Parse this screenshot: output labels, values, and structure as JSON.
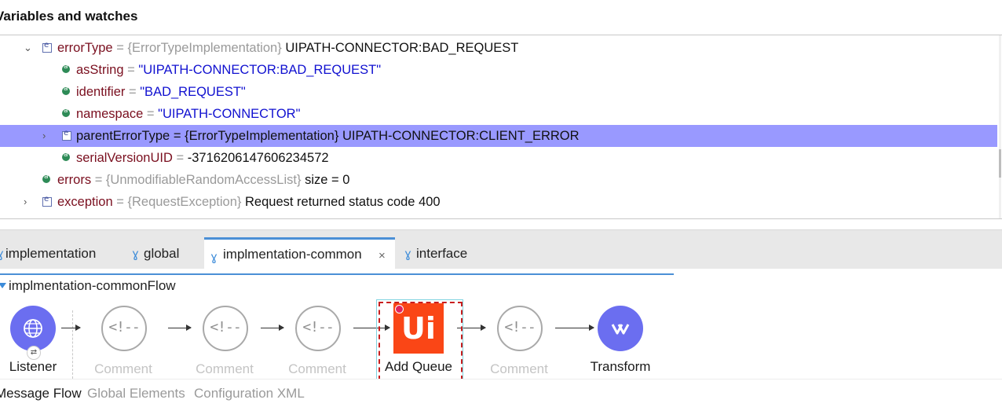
{
  "variables_panel": {
    "title": "Variables and watches",
    "rows": [
      {
        "name": "errorType",
        "sep": "=",
        "type": "{ErrorTypeImplementation}",
        "value": "UIPATH-CONNECTOR:BAD_REQUEST",
        "expanded": true,
        "icon": "entity-icon"
      },
      {
        "name": "asString",
        "sep": "=",
        "value": "\"UIPATH-CONNECTOR:BAD_REQUEST\"",
        "icon": "attribute-icon"
      },
      {
        "name": "identifier",
        "sep": "=",
        "value": "\"BAD_REQUEST\"",
        "icon": "attribute-icon"
      },
      {
        "name": "namespace",
        "sep": "=",
        "value": "\"UIPATH-CONNECTOR\"",
        "icon": "attribute-icon"
      },
      {
        "name": "parentErrorType",
        "sep": "=",
        "type": "{ErrorTypeImplementation}",
        "value": "UIPATH-CONNECTOR:CLIENT_ERROR",
        "expanded": false,
        "selected": true,
        "icon": "entity-icon"
      },
      {
        "name": "serialVersionUID",
        "sep": "=",
        "value": "-3716206147606234572",
        "icon": "attribute-icon"
      },
      {
        "name": "errors",
        "sep": "=",
        "type": "{UnmodifiableRandomAccessList}",
        "value": "size = 0",
        "icon": "attribute-icon"
      },
      {
        "name": "exception",
        "sep": "=",
        "type": "{RequestException}",
        "value": "Request returned status code 400",
        "expanded": false,
        "icon": "entity-icon"
      }
    ]
  },
  "editor_tabs": [
    {
      "label": "implementation",
      "active": false
    },
    {
      "label": "global",
      "active": false
    },
    {
      "label": "implmentation-common",
      "active": true,
      "close": "×"
    },
    {
      "label": "interface",
      "active": false
    }
  ],
  "flow": {
    "title": "implmentation-commonFlow",
    "nodes": [
      {
        "label": "Listener",
        "kind": "listener",
        "icon": "globe-icon"
      },
      {
        "label": "Comment",
        "kind": "comment",
        "glyph": "<!--"
      },
      {
        "label": "Comment",
        "kind": "comment",
        "glyph": "<!--"
      },
      {
        "label": "Comment",
        "kind": "comment",
        "glyph": "<!--"
      },
      {
        "label": "Add Queue",
        "kind": "uipath",
        "glyph": "Ui"
      },
      {
        "label": "Comment",
        "kind": "comment",
        "glyph": "<!--"
      },
      {
        "label": "Transform",
        "kind": "transform",
        "icon": "transform-icon"
      }
    ]
  },
  "bottom_tabs": [
    {
      "label": "Message Flow",
      "active": true
    },
    {
      "label": "Global Elements",
      "active": false
    },
    {
      "label": "Configuration XML",
      "active": false
    }
  ],
  "colors": {
    "selection": "#9999ff",
    "accent": "#4b8fd6",
    "node_purple": "#6b6ef0",
    "uipath_orange": "#fa4616"
  }
}
